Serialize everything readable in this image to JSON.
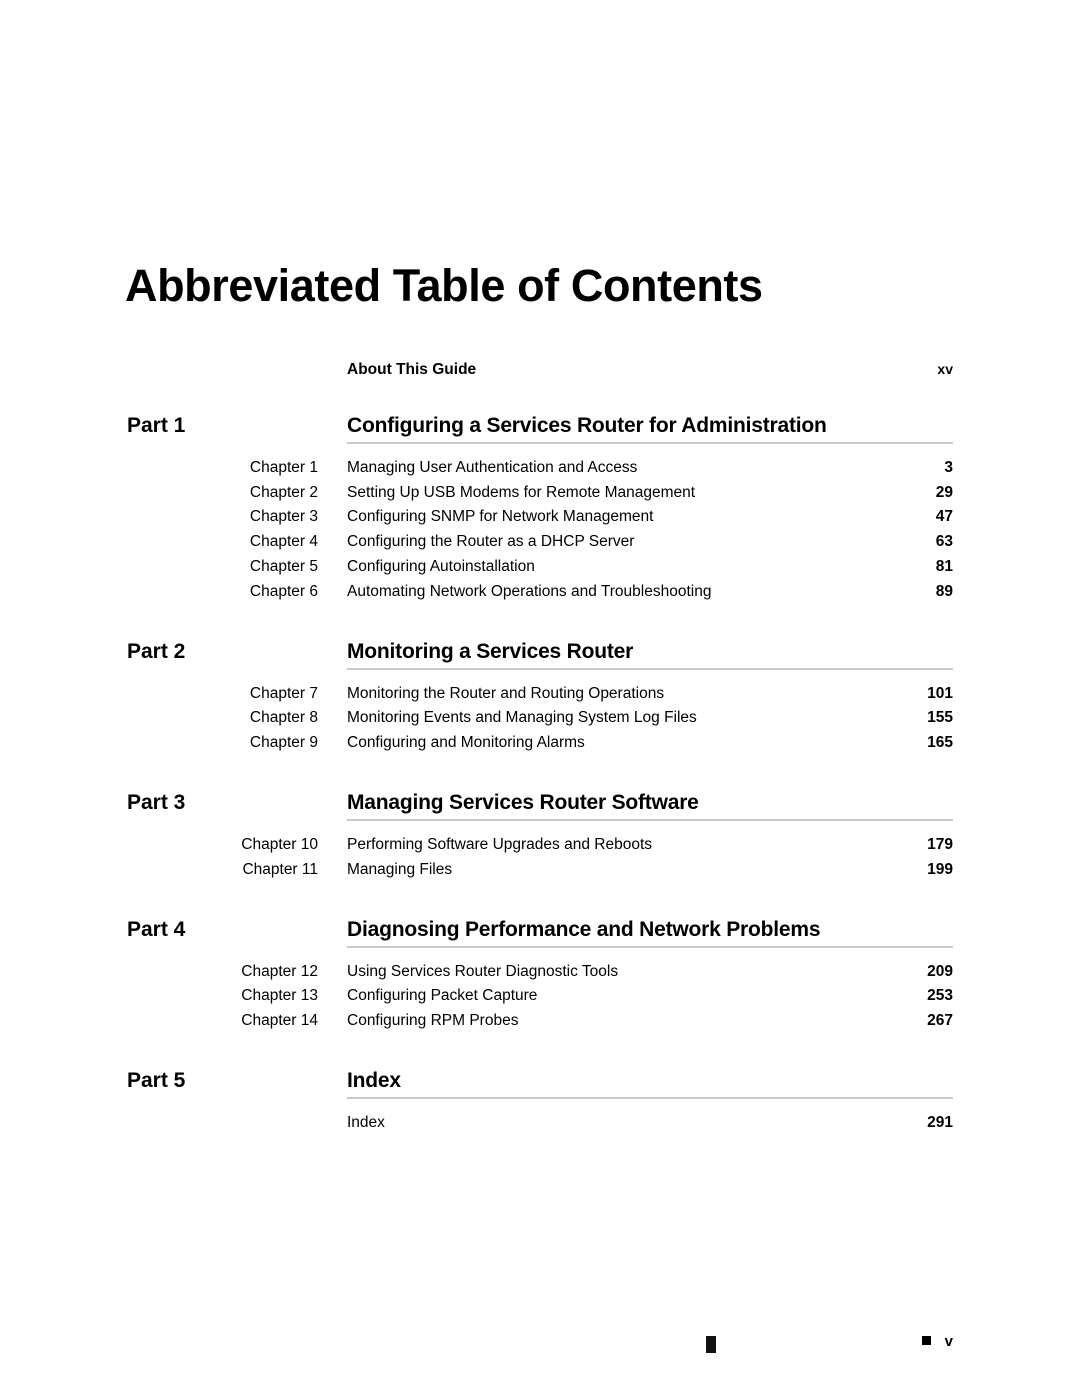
{
  "document": {
    "title": "Abbreviated Table of Contents"
  },
  "frontmatter": [
    {
      "label": "About This Guide",
      "page": "xv"
    }
  ],
  "parts": [
    {
      "part_label": "Part 1",
      "heading": "Configuring a Services Router for Administration",
      "entries": [
        {
          "chapter": "Chapter 1",
          "title": "Managing User Authentication and Access",
          "page": "3"
        },
        {
          "chapter": "Chapter 2",
          "title": "Setting Up USB Modems for Remote Management",
          "page": "29"
        },
        {
          "chapter": "Chapter 3",
          "title": "Configuring SNMP for Network Management",
          "page": "47"
        },
        {
          "chapter": "Chapter 4",
          "title": "Configuring the Router as a DHCP Server",
          "page": "63"
        },
        {
          "chapter": "Chapter 5",
          "title": "Configuring Autoinstallation",
          "page": "81"
        },
        {
          "chapter": "Chapter 6",
          "title": "Automating Network Operations and Troubleshooting",
          "page": "89"
        }
      ]
    },
    {
      "part_label": "Part 2",
      "heading": "Monitoring a Services Router",
      "entries": [
        {
          "chapter": "Chapter 7",
          "title": "Monitoring the Router and Routing Operations",
          "page": "101"
        },
        {
          "chapter": "Chapter 8",
          "title": "Monitoring Events and Managing System Log Files",
          "page": "155"
        },
        {
          "chapter": "Chapter 9",
          "title": "Configuring and Monitoring Alarms",
          "page": "165"
        }
      ]
    },
    {
      "part_label": "Part 3",
      "heading": "Managing Services Router Software",
      "entries": [
        {
          "chapter": "Chapter 10",
          "title": "Performing Software Upgrades and Reboots",
          "page": "179"
        },
        {
          "chapter": "Chapter 11",
          "title": "Managing Files",
          "page": "199"
        }
      ]
    },
    {
      "part_label": "Part 4",
      "heading": "Diagnosing Performance and Network Problems",
      "entries": [
        {
          "chapter": "Chapter 12",
          "title": "Using Services Router Diagnostic Tools",
          "page": "209"
        },
        {
          "chapter": "Chapter 13",
          "title": "Configuring Packet Capture",
          "page": "253"
        },
        {
          "chapter": "Chapter 14",
          "title": "Configuring RPM Probes",
          "page": "267"
        }
      ]
    },
    {
      "part_label": "Part 5",
      "heading": "Index",
      "entries": [
        {
          "chapter": "",
          "title": "Index",
          "page": "291"
        }
      ]
    }
  ],
  "footer": {
    "center_mark": "",
    "bullet": "",
    "page_number": "v"
  }
}
